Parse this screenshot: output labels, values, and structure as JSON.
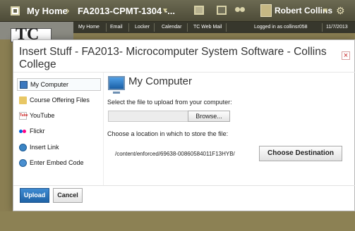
{
  "topbar": {
    "my_home": "My Home",
    "course": "FA2013-CPMT-1304 -...",
    "user": "Robert Collins",
    "icons": [
      "home-icon",
      "mail-icon",
      "message-icon",
      "chat-icon",
      "settings-icon"
    ]
  },
  "subnav": {
    "items": [
      "My Home",
      "Email",
      "Locker",
      "Calendar",
      "TC Web Mail"
    ],
    "logged_in": "Logged in as collinsr058",
    "date": "11/7/2013"
  },
  "background": {
    "logo_text": "TC"
  },
  "modal": {
    "title": "Insert Stuff - FA2013- Microcomputer System Software - Collins College",
    "close": "×",
    "sidebar": [
      {
        "label": "My Computer",
        "icon": "computer-icon",
        "selected": true
      },
      {
        "label": "Course Offering Files",
        "icon": "folder-icon"
      },
      {
        "label": "YouTube",
        "icon": "youtube-icon"
      },
      {
        "label": "Flickr",
        "icon": "flickr-icon"
      },
      {
        "label": "Insert Link",
        "icon": "link-icon"
      },
      {
        "label": "Enter Embed Code",
        "icon": "embed-icon"
      }
    ],
    "main": {
      "title": "My Computer",
      "select_file": "Select the file to upload from your computer:",
      "file_value": "",
      "browse": "Browse...",
      "location_label": "Choose a location in which to store the file:",
      "path": "/content/enforced/69638-00860584011F13HYB/",
      "choose_destination": "Choose Destination"
    },
    "footer": {
      "upload": "Upload",
      "cancel": "Cancel"
    }
  },
  "colors": {
    "accent_blue": "#1f63a6",
    "topbar": "#5c5a44",
    "background": "#8a7e52"
  }
}
